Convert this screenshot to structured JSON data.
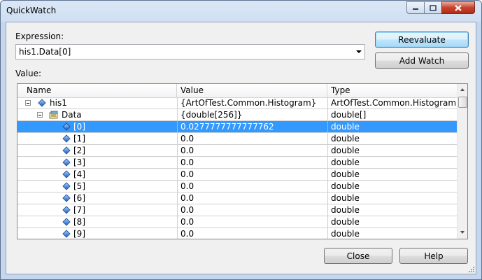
{
  "window": {
    "title": "QuickWatch"
  },
  "expression": {
    "label": "Expression:",
    "value": "his1.Data[0]"
  },
  "buttons": {
    "reevaluate": "Reevaluate",
    "add_watch": "Add Watch",
    "close": "Close",
    "help": "Help"
  },
  "value_label": "Value:",
  "grid": {
    "columns": {
      "name": "Name",
      "value": "Value",
      "type": "Type"
    },
    "rows": [
      {
        "name": "his1",
        "value": "{ArtOfTest.Common.Histogram}",
        "type": "ArtOfTest.Common.Histogram"
      },
      {
        "name": "Data",
        "value": "{double[256]}",
        "type": "double[]"
      },
      {
        "name": "[0]",
        "value": "0.0277777777777762",
        "type": "double"
      },
      {
        "name": "[1]",
        "value": "0.0",
        "type": "double"
      },
      {
        "name": "[2]",
        "value": "0.0",
        "type": "double"
      },
      {
        "name": "[3]",
        "value": "0.0",
        "type": "double"
      },
      {
        "name": "[4]",
        "value": "0.0",
        "type": "double"
      },
      {
        "name": "[5]",
        "value": "0.0",
        "type": "double"
      },
      {
        "name": "[6]",
        "value": "0.0",
        "type": "double"
      },
      {
        "name": "[7]",
        "value": "0.0",
        "type": "double"
      },
      {
        "name": "[8]",
        "value": "0.0",
        "type": "double"
      },
      {
        "name": "[9]",
        "value": "0.0",
        "type": "double"
      }
    ]
  },
  "colors": {
    "selection": "#3399ff",
    "title_bg": "#cfdff1",
    "close_button": "#c7422c"
  }
}
